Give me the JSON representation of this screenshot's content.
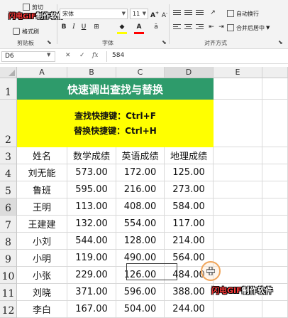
{
  "ribbon": {
    "clipboard": {
      "cut_label": "剪切",
      "copy_label": "复制",
      "format_painter_label": "格式刷",
      "group_label": "剪贴板"
    },
    "font": {
      "font_name": "宋体",
      "font_size": "11",
      "group_label": "字体"
    },
    "alignment": {
      "wrap_label": "自动换行",
      "merge_label": "合并后居中",
      "group_label": "对齐方式"
    }
  },
  "formula_bar": {
    "name_box": "D6",
    "value": "584"
  },
  "columns": [
    "A",
    "B",
    "C",
    "D",
    "E"
  ],
  "selected_column": "D",
  "selected_row": "6",
  "sheet": {
    "title": "快速调出查找与替换",
    "shortcut_find": "查找快捷键：Ctrl+F",
    "shortcut_replace": "替换快捷键：Ctrl+H",
    "headers": [
      "姓名",
      "数学成绩",
      "英语成绩",
      "地理成绩"
    ],
    "rows": [
      {
        "row": "4",
        "cells": [
          "刘无能",
          "573.00",
          "172.00",
          "125.00"
        ]
      },
      {
        "row": "5",
        "cells": [
          "鲁班",
          "595.00",
          "216.00",
          "273.00"
        ]
      },
      {
        "row": "6",
        "cells": [
          "王明",
          "113.00",
          "408.00",
          "584.00"
        ]
      },
      {
        "row": "7",
        "cells": [
          "王建建",
          "132.00",
          "554.00",
          "117.00"
        ]
      },
      {
        "row": "8",
        "cells": [
          "小刘",
          "544.00",
          "128.00",
          "214.00"
        ]
      },
      {
        "row": "9",
        "cells": [
          "小明",
          "119.00",
          "490.00",
          "564.00"
        ]
      },
      {
        "row": "10",
        "cells": [
          "小张",
          "229.00",
          "126.00",
          "484.00"
        ]
      },
      {
        "row": "11",
        "cells": [
          "刘晓",
          "371.00",
          "596.00",
          "388.00"
        ]
      },
      {
        "row": "12",
        "cells": [
          "李白",
          "167.00",
          "504.00",
          "244.00"
        ]
      }
    ],
    "row_labels": [
      "1",
      "2",
      "3"
    ]
  },
  "watermark": {
    "red_part": "闪电GIF",
    "white_part": "制作软件"
  },
  "colors": {
    "title_bg": "#2e9b6b",
    "highlight_bg": "#ffff00",
    "cursor": "#f0a55a"
  }
}
